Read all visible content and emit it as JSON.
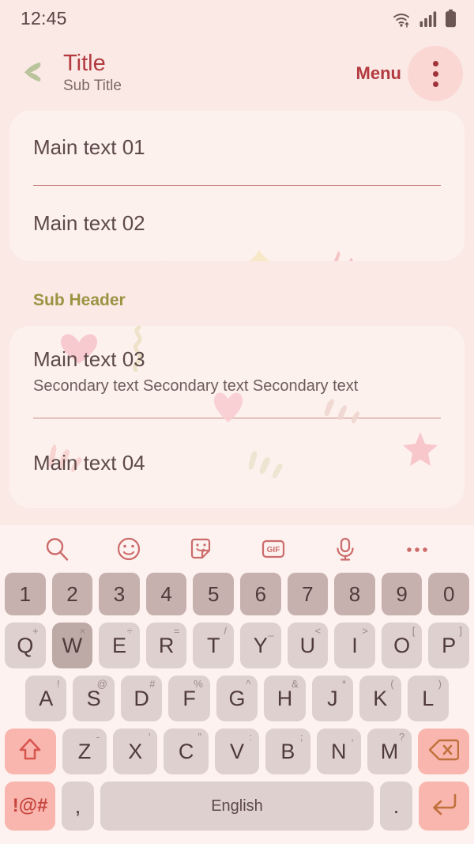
{
  "statusbar": {
    "time": "12:45",
    "icons": [
      "wifi-icon",
      "signal-icon",
      "battery-icon"
    ]
  },
  "appbar": {
    "back_icon": "leaf-back-icon",
    "title": "Title",
    "subtitle": "Sub Title",
    "menu_label": "Menu",
    "overflow_icon": "more-vertical-icon"
  },
  "content": {
    "card1": {
      "rows": [
        {
          "main": "Main text 01"
        },
        {
          "main": "Main text 02"
        }
      ]
    },
    "sub_header": "Sub Header",
    "card2": {
      "rows": [
        {
          "main": "Main text 03",
          "secondary": "Secondary text Secondary text Secondary text"
        },
        {
          "main": "Main text 04"
        }
      ]
    }
  },
  "keyboard": {
    "toolbar": [
      {
        "name": "search-icon"
      },
      {
        "name": "emoji-icon"
      },
      {
        "name": "sticker-icon"
      },
      {
        "name": "gif-icon",
        "label": "GIF"
      },
      {
        "name": "microphone-icon"
      },
      {
        "name": "more-horizontal-icon"
      }
    ],
    "rows": {
      "numbers": [
        {
          "key": "1"
        },
        {
          "key": "2"
        },
        {
          "key": "3"
        },
        {
          "key": "4"
        },
        {
          "key": "5"
        },
        {
          "key": "6"
        },
        {
          "key": "7"
        },
        {
          "key": "8"
        },
        {
          "key": "9"
        },
        {
          "key": "0"
        }
      ],
      "top": [
        {
          "key": "Q",
          "alt": "+"
        },
        {
          "key": "W",
          "alt": "×",
          "pressed": true
        },
        {
          "key": "E",
          "alt": "÷"
        },
        {
          "key": "R",
          "alt": "="
        },
        {
          "key": "T",
          "alt": "/"
        },
        {
          "key": "Y",
          "alt": "_"
        },
        {
          "key": "U",
          "alt": "<"
        },
        {
          "key": "I",
          "alt": ">"
        },
        {
          "key": "O",
          "alt": "["
        },
        {
          "key": "P",
          "alt": "]"
        }
      ],
      "home": [
        {
          "key": "A",
          "alt": "!"
        },
        {
          "key": "S",
          "alt": "@"
        },
        {
          "key": "D",
          "alt": "#"
        },
        {
          "key": "F",
          "alt": "%"
        },
        {
          "key": "G",
          "alt": "^"
        },
        {
          "key": "H",
          "alt": "&"
        },
        {
          "key": "J",
          "alt": "*"
        },
        {
          "key": "K",
          "alt": "("
        },
        {
          "key": "L",
          "alt": ")"
        }
      ],
      "bottomLetters": [
        {
          "key": "Z",
          "alt": "-"
        },
        {
          "key": "X",
          "alt": "'"
        },
        {
          "key": "C",
          "alt": "”"
        },
        {
          "key": "V",
          "alt": ":"
        },
        {
          "key": "B",
          "alt": ";"
        },
        {
          "key": "N",
          "alt": ","
        },
        {
          "key": "M",
          "alt": "?"
        }
      ],
      "shift_icon": "shift-icon",
      "backspace_icon": "backspace-icon",
      "symbols_label": "!@#",
      "comma_label": ",",
      "space_label": "English",
      "period_label": ".",
      "enter_icon": "enter-icon"
    }
  },
  "colors": {
    "background": "#fae9e5",
    "card": "#fdf1ee",
    "title": "#b33a3f",
    "sub_header": "#9a9442",
    "divider": "#c98a88",
    "key": "#ddd0ce",
    "key_number": "#c6b1ae",
    "key_accent": "#f9b6ae",
    "leaf": "#b8c39a"
  }
}
